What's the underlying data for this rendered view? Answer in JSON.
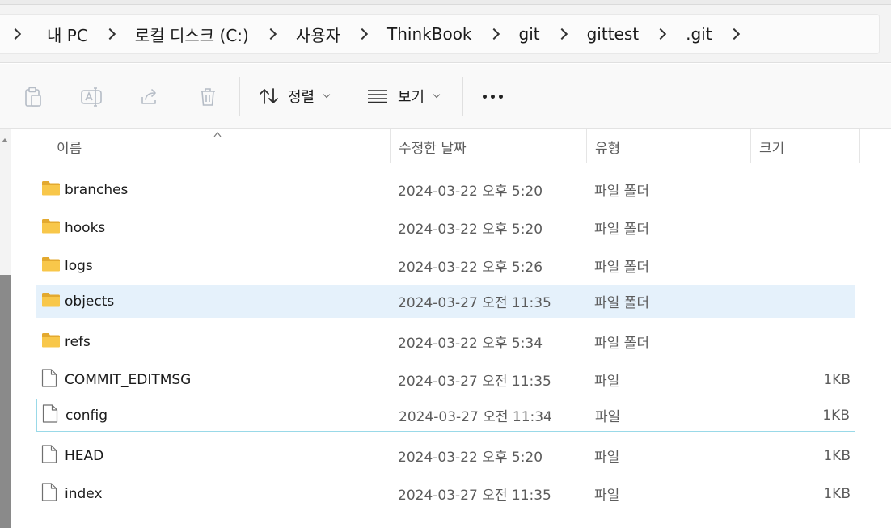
{
  "breadcrumb": [
    "내 PC",
    "로컬 디스크 (C:)",
    "사용자",
    "ThinkBook",
    "git",
    "gittest",
    ".git"
  ],
  "toolbar": {
    "sort_label": "정렬",
    "view_label": "보기"
  },
  "columns": {
    "name": "이름",
    "modified": "수정한 날짜",
    "type": "유형",
    "size": "크기"
  },
  "files": [
    {
      "name": "branches",
      "modified": "2024-03-22 오후 5:20",
      "type": "파일 폴더",
      "size": "",
      "kind": "folder"
    },
    {
      "name": "hooks",
      "modified": "2024-03-22 오후 5:20",
      "type": "파일 폴더",
      "size": "",
      "kind": "folder"
    },
    {
      "name": "logs",
      "modified": "2024-03-22 오후 5:26",
      "type": "파일 폴더",
      "size": "",
      "kind": "folder"
    },
    {
      "name": "objects",
      "modified": "2024-03-27 오전 11:35",
      "type": "파일 폴더",
      "size": "",
      "kind": "folder"
    },
    {
      "name": "refs",
      "modified": "2024-03-22 오후 5:34",
      "type": "파일 폴더",
      "size": "",
      "kind": "folder"
    },
    {
      "name": "COMMIT_EDITMSG",
      "modified": "2024-03-27 오전 11:35",
      "type": "파일",
      "size": "1KB",
      "kind": "file"
    },
    {
      "name": "config",
      "modified": "2024-03-27 오전 11:34",
      "type": "파일",
      "size": "1KB",
      "kind": "file"
    },
    {
      "name": "HEAD",
      "modified": "2024-03-22 오후 5:20",
      "type": "파일",
      "size": "1KB",
      "kind": "file"
    },
    {
      "name": "index",
      "modified": "2024-03-27 오전 11:35",
      "type": "파일",
      "size": "1KB",
      "kind": "file"
    }
  ],
  "selected_index": 3,
  "focused_index": 6,
  "colors": {
    "folder": "#f8c74a",
    "selection": "#e5f1fb",
    "focus_border": "#99d9e8"
  }
}
